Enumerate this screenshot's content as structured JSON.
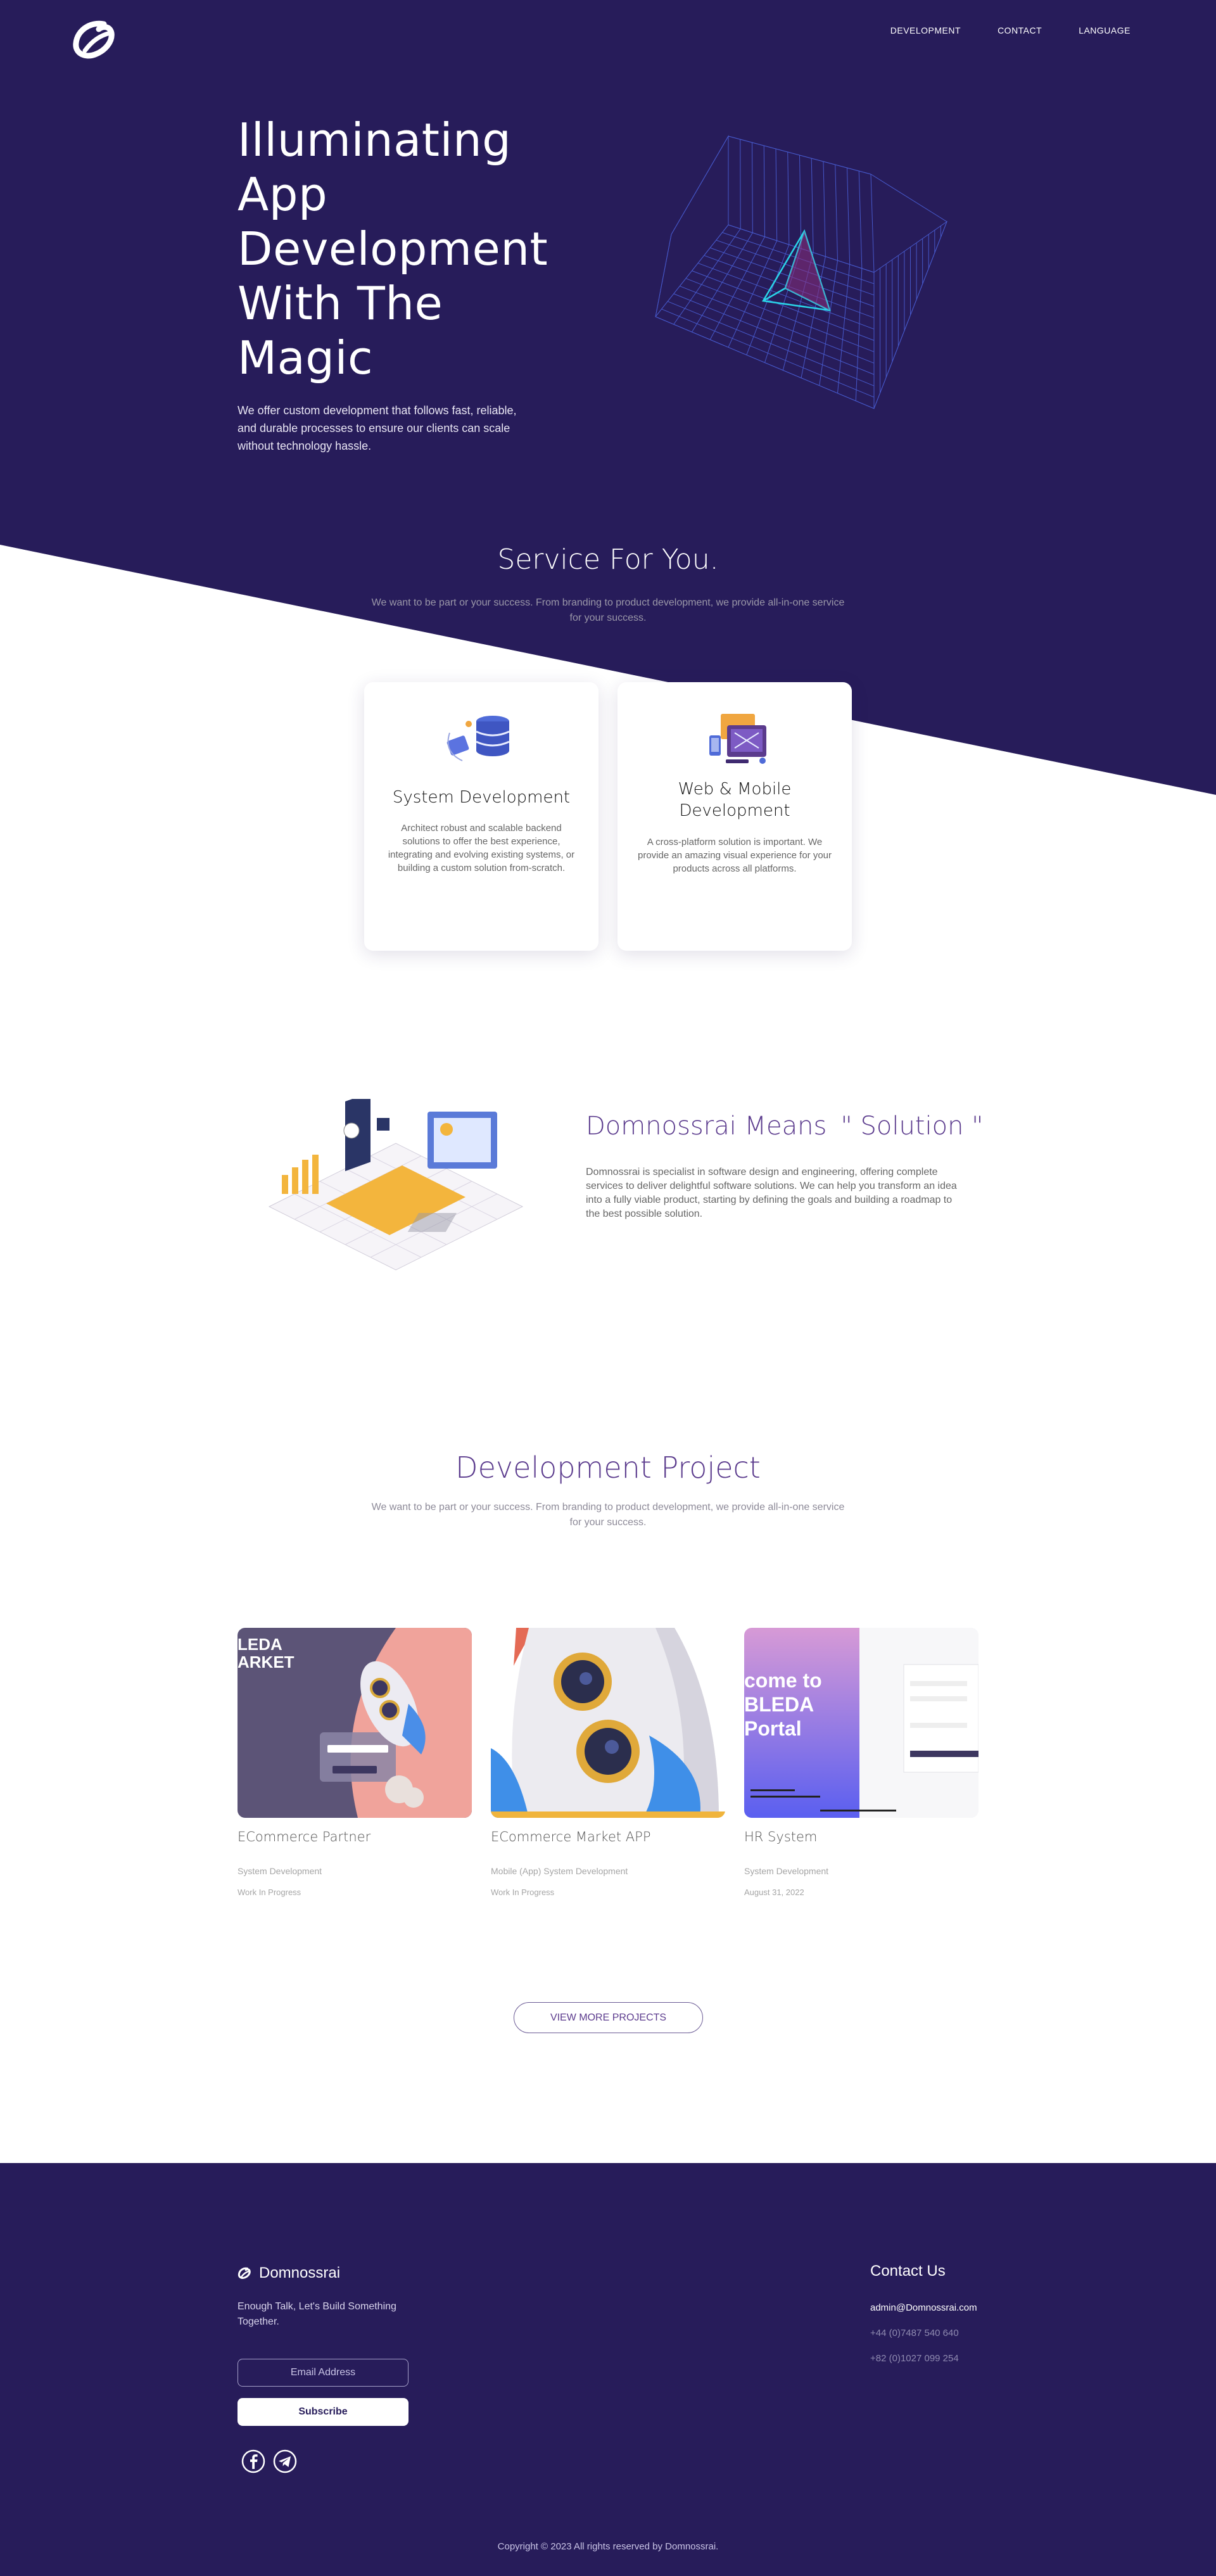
{
  "colors": {
    "hero_bg": "#271c5a",
    "accent": "#5b3b8d",
    "cyan": "#2ad4e8",
    "white": "#ffffff"
  },
  "nav": {
    "items": [
      "DEVELOPMENT",
      "CONTACT",
      "LANGUAGE"
    ]
  },
  "hero": {
    "title": "Illuminating App Development With The Magic",
    "description": "We offer custom development that follows fast, reliable, and durable processes to ensure our clients can scale without technology hassle."
  },
  "services": {
    "title": "Service For You.",
    "subtitle": "We want to be part or your success. From branding to product development, we provide all-in-one service for your success.",
    "cards": [
      {
        "icon": "database-icon",
        "title": "System Development",
        "text": "Architect robust and scalable backend solutions to offer the best experience, integrating and evolving existing systems, or building a custom solution from-scratch."
      },
      {
        "icon": "devices-icon",
        "title": "Web & Mobile Development",
        "text": "A cross-platform solution is important. We provide an amazing visual experience for your products across all platforms."
      }
    ]
  },
  "solution": {
    "title": "Domnossrai Means",
    "highlight": "\" Solution  \"",
    "text": "Domnossrai is specialist in software design and engineering, offering complete services to deliver delightful software solutions. We can help you transform an idea into a fully viable product, starting by defining the goals and building a roadmap to the best possible solution."
  },
  "projects": {
    "title": "Development Project",
    "subtitle": "We want to be part or your success. From branding to product development, we provide all-in-one service for your success.",
    "items": [
      {
        "name": "ECommerce Partner",
        "category": "System Development",
        "status": "Work In Progress",
        "thumb_text": "LEDA\nARKET"
      },
      {
        "name": "ECommerce Market APP",
        "category": "Mobile (App) System Development",
        "status": "Work In Progress"
      },
      {
        "name": "HR System",
        "category": "System Development",
        "status": "August 31, 2022",
        "thumb_text": "come to\nBLEDA\nPortal"
      }
    ],
    "more_label": "VIEW MORE PROJECTS"
  },
  "footer": {
    "brand": "Domnossrai",
    "tagline": "Enough Talk, Let's Build Something Together.",
    "email_placeholder": "Email Address",
    "subscribe_label": "Subscribe",
    "social": [
      "facebook-icon",
      "telegram-icon"
    ],
    "contact_title": "Contact Us",
    "email": "admin@Domnossrai.com",
    "phones": [
      "+44 (0)7487 540 640",
      "+82 (0)1027 099 254"
    ],
    "copyright": "Copyright © 2023 All rights reserved by Domnossrai."
  }
}
